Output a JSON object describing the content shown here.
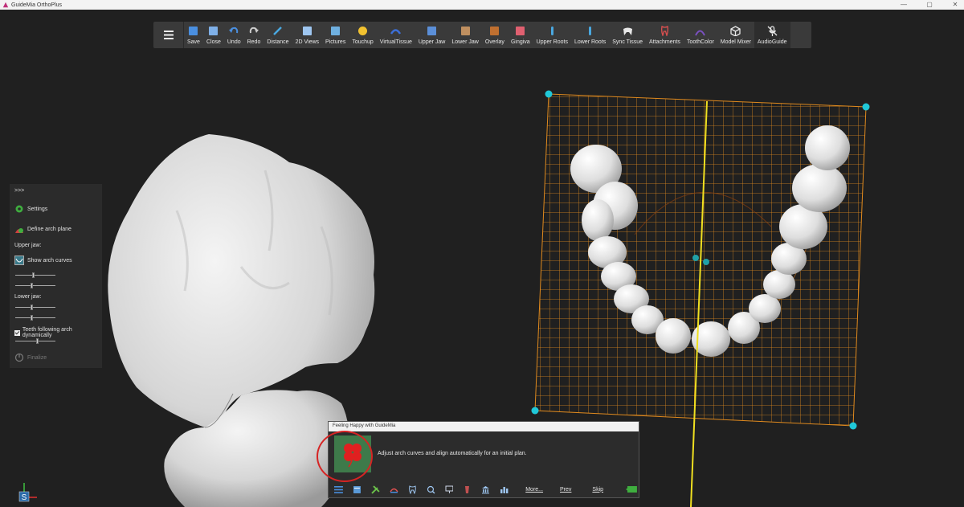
{
  "window": {
    "title": "GuideMia OrthoPlus",
    "controls": [
      "—",
      "▢",
      "✕"
    ]
  },
  "toolbar": {
    "menu_icon": "hamburger-icon",
    "items": [
      {
        "label": "Save",
        "icon": "save-icon",
        "color": "#4a8fe0"
      },
      {
        "label": "Close",
        "icon": "close-file-icon",
        "color": "#7fb0e8"
      },
      {
        "label": "Undo",
        "icon": "undo-icon",
        "color": "#4a8fe0"
      },
      {
        "label": "Redo",
        "icon": "redo-icon",
        "color": "#cccccc"
      },
      {
        "label": "Distance",
        "icon": "ruler-icon",
        "color": "#4aa8e0"
      },
      {
        "label": "2D Views",
        "icon": "2d-views-icon",
        "color": "#9ec6f0"
      },
      {
        "label": "Pictures",
        "icon": "pictures-icon",
        "color": "#6fb0e0"
      },
      {
        "label": "Touchup",
        "icon": "touchup-icon",
        "color": "#f2c230"
      },
      {
        "label": "VirtualTissue",
        "icon": "virtual-tissue-icon",
        "color": "#3c6fd8"
      },
      {
        "label": "Upper Jaw",
        "icon": "upper-jaw-icon",
        "color": "#5b8fd8"
      },
      {
        "label": "Lower Jaw",
        "icon": "lower-jaw-icon",
        "color": "#c09060"
      },
      {
        "label": "Overlay",
        "icon": "overlay-icon",
        "color": "#c07030"
      },
      {
        "label": "Gingiva",
        "icon": "gingiva-icon",
        "color": "#e06070"
      },
      {
        "label": "Upper Roots",
        "icon": "upper-roots-icon",
        "color": "#4aa8e0"
      },
      {
        "label": "Lower Roots",
        "icon": "lower-roots-icon",
        "color": "#4aa8e0"
      },
      {
        "label": "Sync Tissue",
        "icon": "sync-tissue-icon",
        "color": "#e8e8e8"
      },
      {
        "label": "Attachments",
        "icon": "attachments-icon",
        "color": "#e05050"
      },
      {
        "label": "ToothColor",
        "icon": "tooth-color-icon",
        "color": "#7a50c0"
      },
      {
        "label": "Model Mixer",
        "icon": "model-mixer-icon",
        "color": "#e8e8e8"
      },
      {
        "label": "AudioGuide",
        "icon": "audio-guide-icon",
        "color": "#e8e8e8"
      }
    ]
  },
  "left_panel": {
    "expand": ">>>",
    "settings": "Settings",
    "define_arch_plane": "Define arch plane",
    "upper_jaw": "Upper jaw:",
    "show_arch_curves": "Show arch curves",
    "lower_jaw": "Lower jaw:",
    "teeth_following": "Teeth following arch dynamically",
    "teeth_following_checked": true,
    "finalize": "Finalize",
    "sliders": {
      "upper_1": 0.45,
      "upper_2": 0.4,
      "lower_1": 0.4,
      "lower_2": 0.4,
      "teeth": 0.55
    }
  },
  "popup": {
    "title": "Feeling Happy with GuideMia",
    "text": "Adjust arch curves and align automatically for an initial plan.",
    "image_icon": "four-leaf-clover-icon",
    "bar_icons": [
      "list-icon",
      "book-icon",
      "tools-icon",
      "arch-icon",
      "tooth-icon",
      "search-tooth-icon",
      "presentation-icon",
      "implant-icon",
      "bank-icon",
      "chart-icon"
    ],
    "links": {
      "more": "More...",
      "prev": "Prev",
      "skip": "Skip"
    },
    "next_icon": "next-slide-icon"
  },
  "gizmo": {
    "label": "S"
  },
  "colors": {
    "grid": "#e08a1e",
    "axis": "#f0e020",
    "handle": "#20c8d8",
    "highlight": "#d62424"
  }
}
